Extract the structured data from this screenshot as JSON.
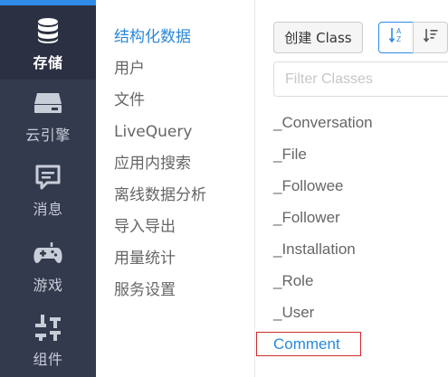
{
  "rail": {
    "items": [
      {
        "label": "存储",
        "icon": "database-icon"
      },
      {
        "label": "云引擎",
        "icon": "server-icon"
      },
      {
        "label": "消息",
        "icon": "message-icon"
      },
      {
        "label": "游戏",
        "icon": "gamepad-icon"
      },
      {
        "label": "组件",
        "icon": "components-icon"
      }
    ],
    "active_index": 0,
    "accent_color": "#2f8be6",
    "background_color": "#343a4e"
  },
  "subnav": {
    "items": [
      {
        "label": "结构化数据"
      },
      {
        "label": "用户"
      },
      {
        "label": "文件"
      },
      {
        "label": "LiveQuery"
      },
      {
        "label": "应用内搜索"
      },
      {
        "label": "离线数据分析"
      },
      {
        "label": "导入导出"
      },
      {
        "label": "用量统计"
      },
      {
        "label": "服务设置"
      }
    ],
    "active_index": 0,
    "active_color": "#2b89d9"
  },
  "panel": {
    "create_button_label": "创建 Class",
    "sort_alpha_icon": "sort-alpha-icon",
    "sort_order_icon": "sort-order-icon",
    "filter_placeholder": "Filter Classes",
    "classes": [
      {
        "name": "_Conversation"
      },
      {
        "name": "_File"
      },
      {
        "name": "_Followee"
      },
      {
        "name": "_Follower"
      },
      {
        "name": "_Installation"
      },
      {
        "name": "_Role"
      },
      {
        "name": "_User"
      },
      {
        "name": "Comment"
      }
    ],
    "selected_index": 7,
    "highlight_color": "#cf2b2b"
  }
}
